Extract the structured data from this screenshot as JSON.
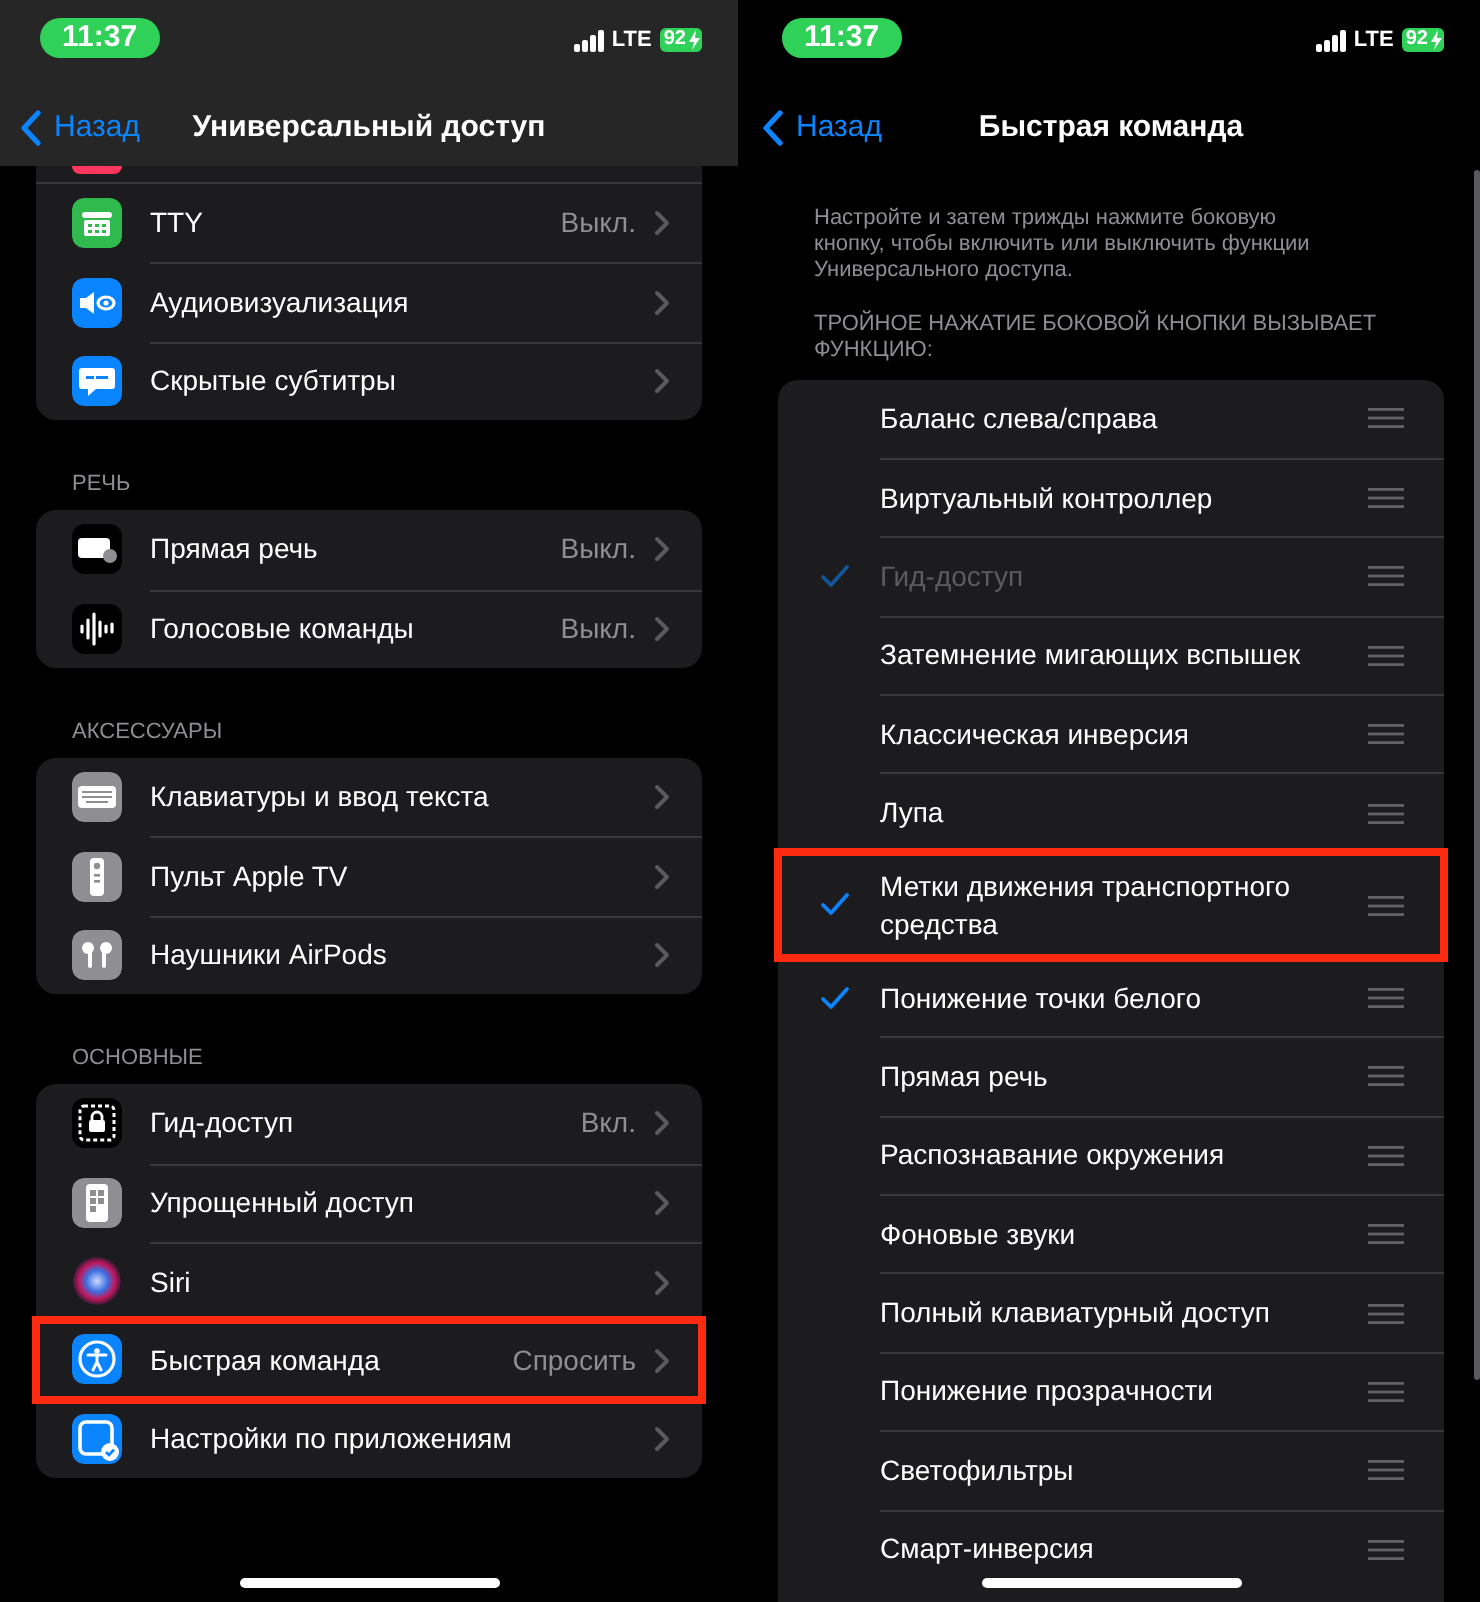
{
  "left_screen": {
    "status_bar": {
      "time": "11:37",
      "network": "LTE",
      "battery": "92"
    },
    "nav": {
      "back": "Назад",
      "title": "Универсальный доступ"
    },
    "sections": [
      {
        "rows": [
          {
            "kind": "cut",
            "highlighted": false
          },
          {
            "kind": "row",
            "label": "TTY",
            "value": "Выкл.",
            "highlighted": false
          },
          {
            "kind": "row",
            "label": "Аудиовизуализация",
            "highlighted": false
          },
          {
            "kind": "row",
            "label": "Скрытые субтитры",
            "highlighted": false
          }
        ]
      },
      {
        "header": "РЕЧЬ",
        "rows": [
          {
            "kind": "row",
            "label": "Прямая речь",
            "value": "Выкл.",
            "highlighted": false
          },
          {
            "kind": "row",
            "label": "Голосовые команды",
            "value": "Выкл.",
            "highlighted": false
          }
        ]
      },
      {
        "header": "АКСЕССУАРЫ",
        "rows": [
          {
            "kind": "row",
            "label": "Клавиатуры и ввод текста",
            "highlighted": false
          },
          {
            "kind": "row",
            "label": "Пульт Apple TV",
            "highlighted": false
          },
          {
            "kind": "row",
            "label": "Наушники AirPods",
            "highlighted": false
          }
        ]
      },
      {
        "header": "ОСНОВНЫЕ",
        "rows": [
          {
            "kind": "row",
            "label": "Гид-доступ",
            "value": "Вкл.",
            "highlighted": false
          },
          {
            "kind": "row",
            "label": "Упрощенный доступ",
            "highlighted": false
          },
          {
            "kind": "row",
            "label": "Siri",
            "highlighted": false
          },
          {
            "kind": "row",
            "label": "Быстрая команда",
            "value": "Спросить",
            "highlighted": true
          },
          {
            "kind": "row",
            "label": "Настройки по приложениям",
            "highlighted": false
          }
        ]
      }
    ]
  },
  "right_screen": {
    "status_bar": {
      "time": "11:37",
      "network": "LTE",
      "battery": "92"
    },
    "nav": {
      "back": "Назад",
      "title": "Быстрая команда"
    },
    "description": "Настройте и затем трижды нажмите боковую кнопку, чтобы включить или выключить функции Универсального доступа.",
    "list_header": "ТРОЙНОЕ НАЖАТИЕ БОКОВОЙ КНОПКИ ВЫЗЫВАЕТ ФУНКЦИЮ:",
    "options": [
      {
        "label": "Баланс слева/справа",
        "checked": false,
        "disabled": false,
        "highlighted": false
      },
      {
        "label": "Виртуальный контроллер",
        "checked": false,
        "disabled": false,
        "highlighted": false
      },
      {
        "label": "Гид-доступ",
        "checked": true,
        "disabled": true,
        "highlighted": false
      },
      {
        "label": "Затемнение мигающих вспышек",
        "checked": false,
        "disabled": false,
        "highlighted": false
      },
      {
        "label": "Классическая инверсия",
        "checked": false,
        "disabled": false,
        "highlighted": false
      },
      {
        "label": "Лупа",
        "checked": false,
        "disabled": false,
        "highlighted": false
      },
      {
        "label": "Метки движения транспортного средства",
        "checked": true,
        "disabled": false,
        "highlighted": true
      },
      {
        "label": "Понижение точки белого",
        "checked": true,
        "disabled": false,
        "highlighted": false
      },
      {
        "label": "Прямая речь",
        "checked": false,
        "disabled": false,
        "highlighted": false
      },
      {
        "label": "Распознавание окружения",
        "checked": false,
        "disabled": false,
        "highlighted": false
      },
      {
        "label": "Фоновые звуки",
        "checked": false,
        "disabled": false,
        "highlighted": false
      },
      {
        "label": "Полный клавиатурный доступ",
        "checked": false,
        "disabled": false,
        "highlighted": false
      },
      {
        "label": "Понижение прозрачности",
        "checked": false,
        "disabled": false,
        "highlighted": false
      },
      {
        "label": "Светофильтры",
        "checked": false,
        "disabled": false,
        "highlighted": false
      },
      {
        "label": "Смарт-инверсия",
        "checked": false,
        "disabled": false,
        "highlighted": false
      }
    ]
  }
}
